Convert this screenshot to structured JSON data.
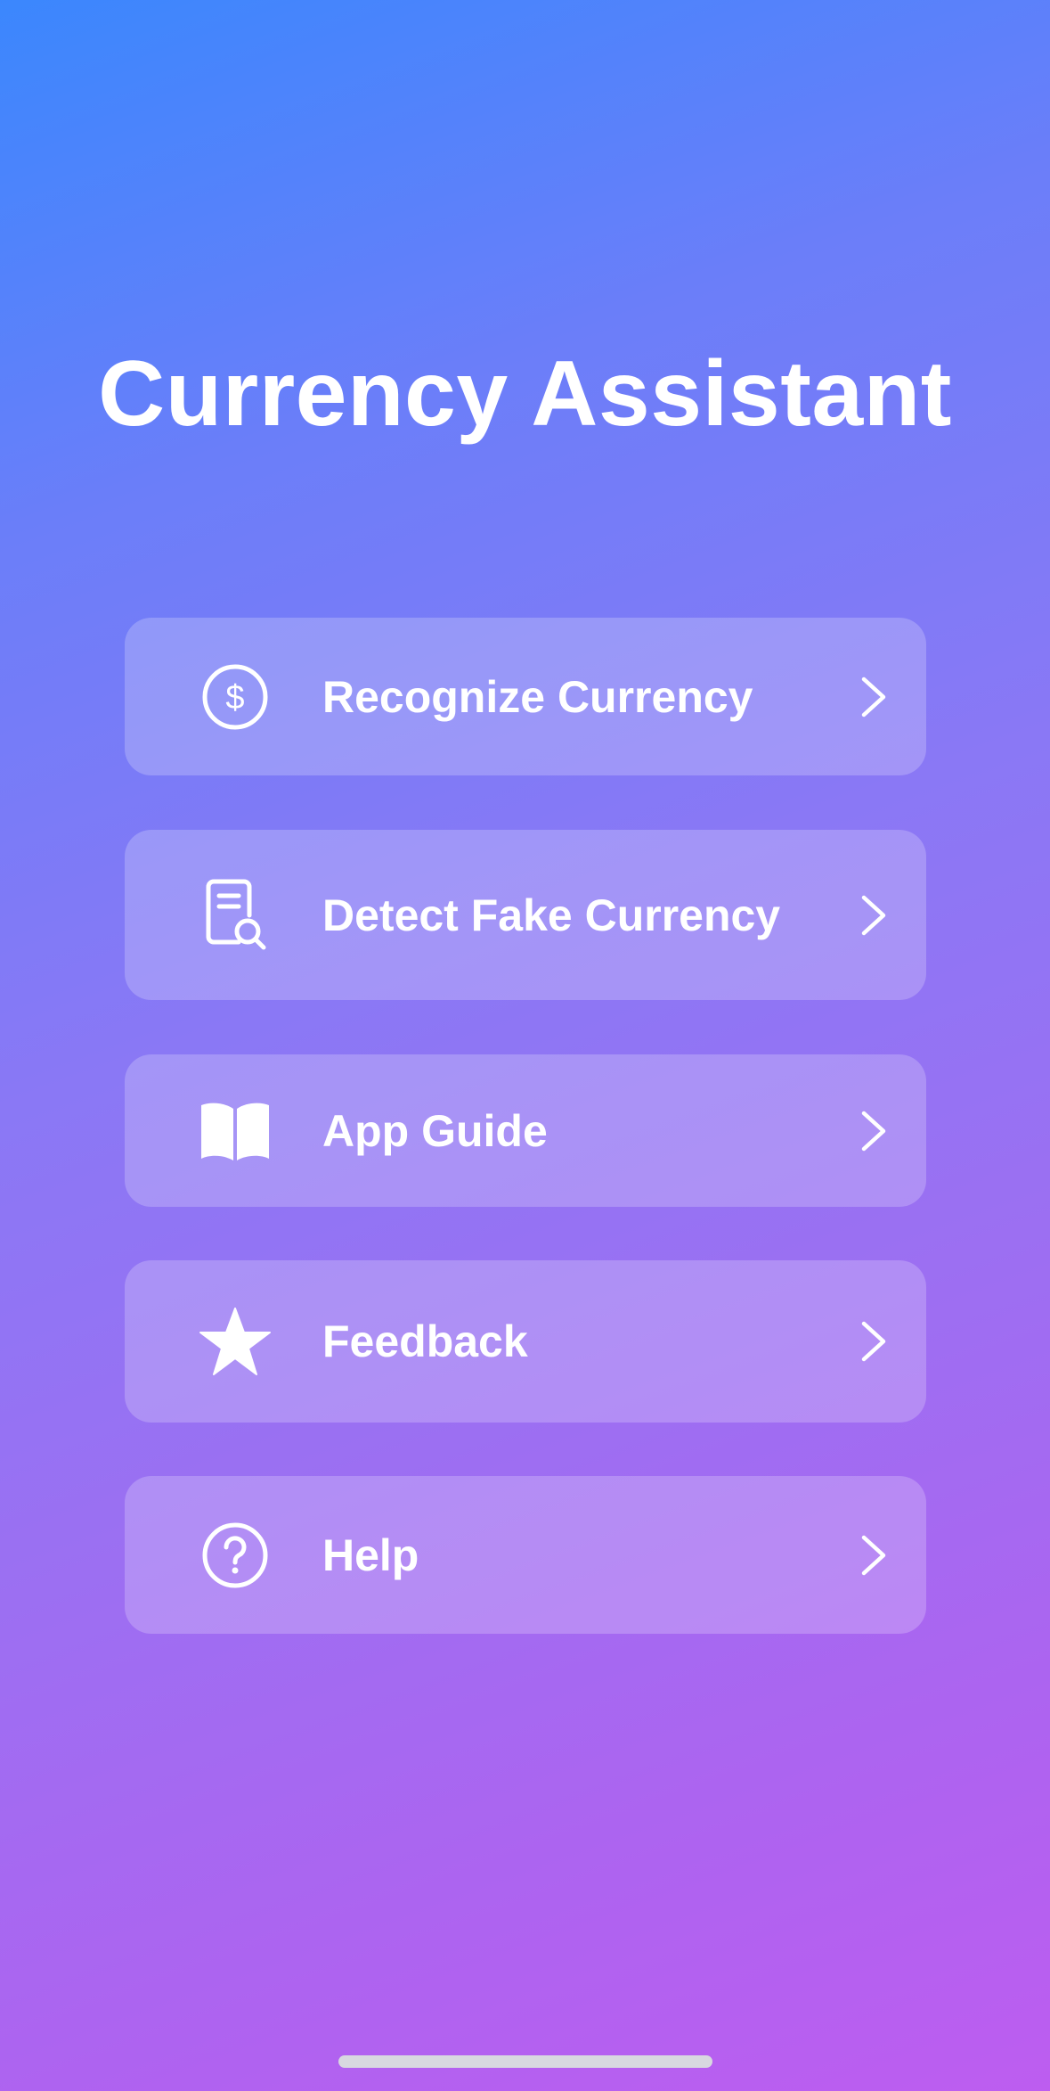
{
  "app": {
    "title": "Currency Assistant"
  },
  "menu": {
    "items": [
      {
        "label": "Recognize Currency",
        "icon": "dollar-circle-icon"
      },
      {
        "label": "Detect Fake Currency",
        "icon": "document-search-icon"
      },
      {
        "label": "App Guide",
        "icon": "book-icon"
      },
      {
        "label": "Feedback",
        "icon": "star-icon"
      },
      {
        "label": "Help",
        "icon": "question-circle-icon"
      }
    ]
  },
  "colors": {
    "gradient_start": "#3b87fd",
    "gradient_end": "#bd5df0",
    "card_background": "rgba(255,255,255,0.22)",
    "text": "#ffffff"
  }
}
